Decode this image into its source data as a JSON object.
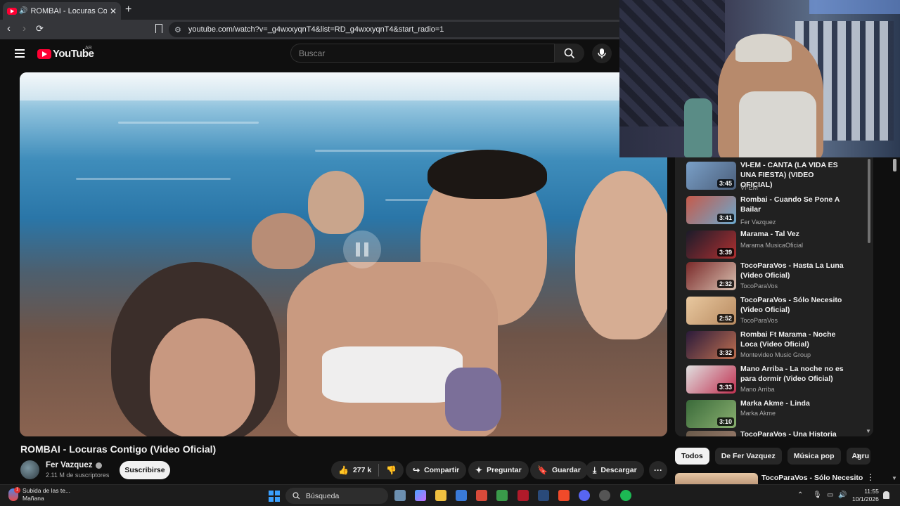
{
  "browser": {
    "tab_title": "ROMBAI - Locuras Contigo (Vide",
    "url": "youtube.com/watch?v=_g4wxxyqnT4&list=RD_g4wxxyqnT4&start_radio=1"
  },
  "header": {
    "logo_text": "YouTube",
    "country_code": "AR",
    "search_placeholder": "Buscar"
  },
  "video": {
    "title": "ROMBAI - Locuras Contigo (Video Oficial)",
    "channel": "Fer Vazquez",
    "subscribers": "2.11 M de suscriptores",
    "subscribe_label": "Suscribirse",
    "likes": "277 k",
    "share_label": "Compartir",
    "ask_label": "Preguntar",
    "save_label": "Guardar",
    "download_label": "Descargar"
  },
  "sidebar": {
    "items": [
      {
        "title": "VI-EM - CANTA (LA VIDA ES UNA FIESTA) (VIDEO OFICIAL)",
        "channel": "VI-EM",
        "duration": "3:45",
        "thumb": [
          "#7aa0c8",
          "#4b5e7a"
        ]
      },
      {
        "title": "Rombai - Cuando Se Pone A Bailar",
        "channel": "Fer Vazquez",
        "duration": "3:41",
        "thumb": [
          "#c65a4a",
          "#6aa9cf"
        ]
      },
      {
        "title": "Marama - Tal Vez",
        "channel": "Marama MusicaOficial",
        "duration": "3:39",
        "thumb": [
          "#1b1b2a",
          "#b03030"
        ]
      },
      {
        "title": "TocoParaVos - Hasta La Luna (Video Oficial)",
        "channel": "TocoParaVos",
        "duration": "2:32",
        "thumb": [
          "#7a2a2a",
          "#d8c0b0"
        ]
      },
      {
        "title": "TocoParaVos - Sólo Necesito (Video Oficial)",
        "channel": "TocoParaVos",
        "duration": "2:52",
        "thumb": [
          "#e9c9a0",
          "#b88a60"
        ]
      },
      {
        "title": "Rombai Ft Marama - Noche Loca (Video Oficial)",
        "channel": "Montevideo Music Group",
        "duration": "3:32",
        "thumb": [
          "#2a1a3a",
          "#c07050"
        ]
      },
      {
        "title": "Mano Arriba - La noche no es para dormir (Video Oficial)",
        "channel": "Mano Arriba",
        "duration": "3:33",
        "thumb": [
          "#e0e0e0",
          "#c03050"
        ]
      },
      {
        "title": "Marka Akme - Linda",
        "channel": "Marka Akme",
        "duration": "3:10",
        "thumb": [
          "#3a6a3a",
          "#8ab070"
        ]
      },
      {
        "title": "TocoParaVos - Una Historia",
        "channel": "",
        "duration": "",
        "thumb": [
          "#6a5a4a",
          "#a08070"
        ]
      }
    ]
  },
  "chips": [
    "Todos",
    "De Fer Vazquez",
    "Música pop",
    "Agru"
  ],
  "next_rec_title": "TocoParaVos - Sólo Necesito",
  "taskbar": {
    "weather_title": "Subida de las te...",
    "weather_sub": "Mañana",
    "weather_badge": "1",
    "search_label": "Búsqueda",
    "time": "11:55",
    "date": "10/1/2026"
  }
}
